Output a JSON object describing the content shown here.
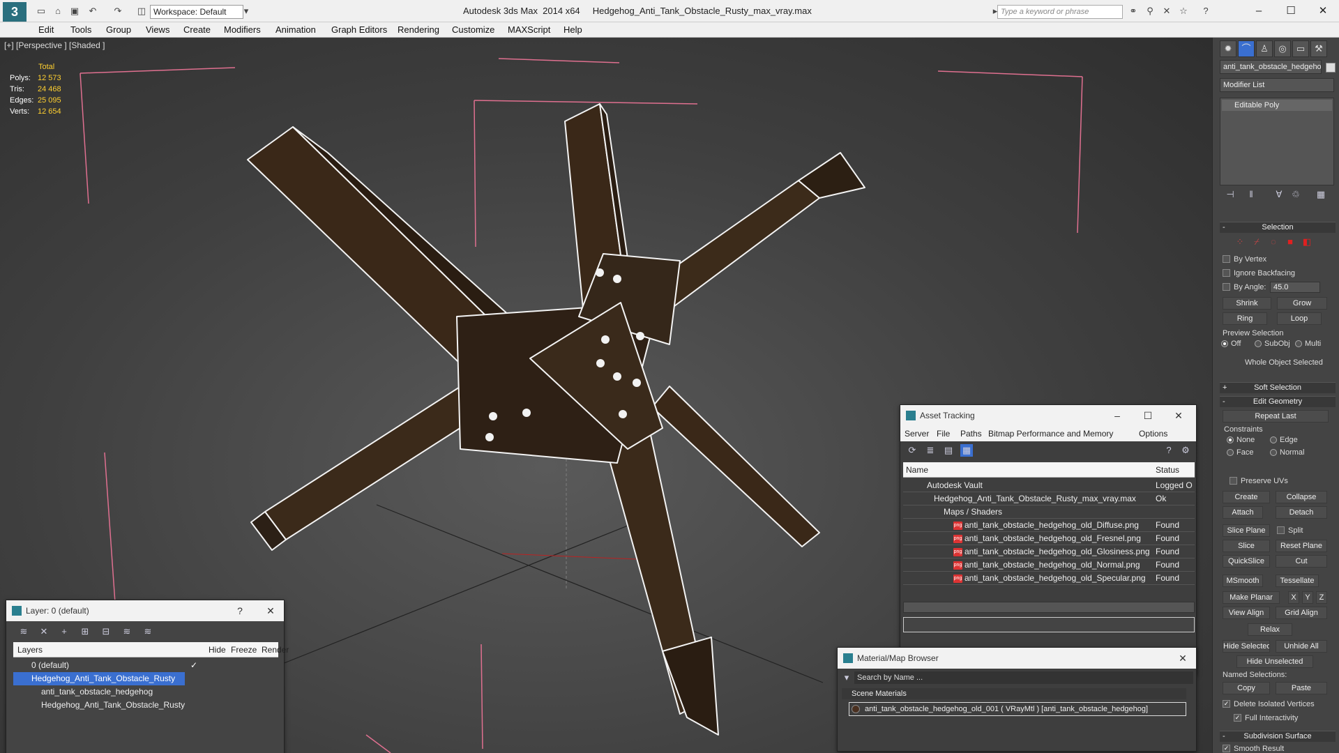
{
  "app": {
    "title": "Autodesk 3ds Max  2014 x64     Hedgehog_Anti_Tank_Obstacle_Rusty_max_vray.max",
    "logo": "3ds-max-logo",
    "workspace": "Workspace: Default",
    "search_placeholder": "Type a keyword or phrase",
    "window_controls": {
      "minimize": "–",
      "maximize": "☐",
      "close": "✕"
    }
  },
  "menu": [
    "Edit",
    "Tools",
    "Group",
    "Views",
    "Create",
    "Modifiers",
    "Animation",
    "Graph Editors",
    "Rendering",
    "Customize",
    "MAXScript",
    "Help"
  ],
  "viewport": {
    "label": "[+] [Perspective ] [Shaded ]",
    "stats": {
      "header": "Total",
      "rows": [
        {
          "k": "Polys:",
          "v": "12 573"
        },
        {
          "k": "Tris:",
          "v": "24 468"
        },
        {
          "k": "Edges:",
          "v": "25 095"
        },
        {
          "k": "Verts:",
          "v": "12 654"
        }
      ]
    }
  },
  "command_panel": {
    "object_name": "anti_tank_obstacle_hedgehog",
    "modifier_list": "Modifier List",
    "stack": [
      "Editable Poly"
    ],
    "selection": {
      "title": "Selection",
      "by_vertex": "By Vertex",
      "ignore_backfacing": "Ignore Backfacing",
      "by_angle": "By Angle:",
      "angle_value": "45.0",
      "shrink": "Shrink",
      "grow": "Grow",
      "ring": "Ring",
      "loop": "Loop",
      "preview_selection": "Preview Selection",
      "preview_options": [
        "Off",
        "SubObj",
        "Multi"
      ],
      "whole_object": "Whole Object Selected"
    },
    "soft_selection": "Soft Selection",
    "edit_geometry": {
      "title": "Edit Geometry",
      "repeat_last": "Repeat Last",
      "constraints": "Constraints",
      "constraint_options": [
        "None",
        "Edge",
        "Face",
        "Normal"
      ],
      "preserve_uvs": "Preserve UVs",
      "create": "Create",
      "collapse": "Collapse",
      "attach": "Attach",
      "detach": "Detach",
      "slice_plane": "Slice Plane",
      "split": "Split",
      "slice": "Slice",
      "reset_plane": "Reset Plane",
      "quickslice": "QuickSlice",
      "cut": "Cut",
      "msmooth": "MSmooth",
      "tessellate": "Tessellate",
      "make_planar": "Make Planar",
      "x": "X",
      "y": "Y",
      "z": "Z",
      "view_align": "View Align",
      "grid_align": "Grid Align",
      "relax": "Relax",
      "hide_selected": "Hide Selected",
      "unhide_all": "Unhide All",
      "hide_unselected": "Hide Unselected",
      "named_selections": "Named Selections:",
      "copy": "Copy",
      "paste": "Paste",
      "delete_isolated": "Delete Isolated Vertices",
      "full_interactivity": "Full Interactivity"
    },
    "subdivision_surface": "Subdivision Surface",
    "smooth_result": "Smooth Result"
  },
  "asset_tracking": {
    "title": "Asset Tracking",
    "menu": [
      "Server",
      "File",
      "Paths",
      "Bitmap Performance and Memory",
      "Options"
    ],
    "columns": [
      "Name",
      "Status"
    ],
    "rows": [
      {
        "name": "Autodesk Vault",
        "status": "Logged O"
      },
      {
        "name": "Hedgehog_Anti_Tank_Obstacle_Rusty_max_vray.max",
        "status": "Ok"
      },
      {
        "name": "Maps / Shaders",
        "status": ""
      },
      {
        "name": "anti_tank_obstacle_hedgehog_old_Diffuse.png",
        "status": "Found"
      },
      {
        "name": "anti_tank_obstacle_hedgehog_old_Fresnel.png",
        "status": "Found"
      },
      {
        "name": "anti_tank_obstacle_hedgehog_old_Glosiness.png",
        "status": "Found"
      },
      {
        "name": "anti_tank_obstacle_hedgehog_old_Normal.png",
        "status": "Found"
      },
      {
        "name": "anti_tank_obstacle_hedgehog_old_Specular.png",
        "status": "Found"
      }
    ]
  },
  "layer_window": {
    "title": "Layer: 0 (default)",
    "help": "?",
    "columns": [
      "Layers",
      "Hide",
      "Freeze",
      "Render"
    ],
    "rows": [
      {
        "name": "0 (default)"
      },
      {
        "name": "Hedgehog_Anti_Tank_Obstacle_Rusty"
      },
      {
        "name": "anti_tank_obstacle_hedgehog"
      },
      {
        "name": "Hedgehog_Anti_Tank_Obstacle_Rusty"
      }
    ]
  },
  "material_browser": {
    "title": "Material/Map Browser",
    "search_placeholder": "Search by Name ...",
    "group": "Scene Materials",
    "item": "anti_tank_obstacle_hedgehog_old_001 ( VRayMtl ) [anti_tank_obstacle_hedgehog]"
  },
  "colors": {
    "accent": "#2a6f7e",
    "stat_value": "#ffd030",
    "selection_highlight": "#3a6fd0",
    "selection_red": "#e02020"
  }
}
